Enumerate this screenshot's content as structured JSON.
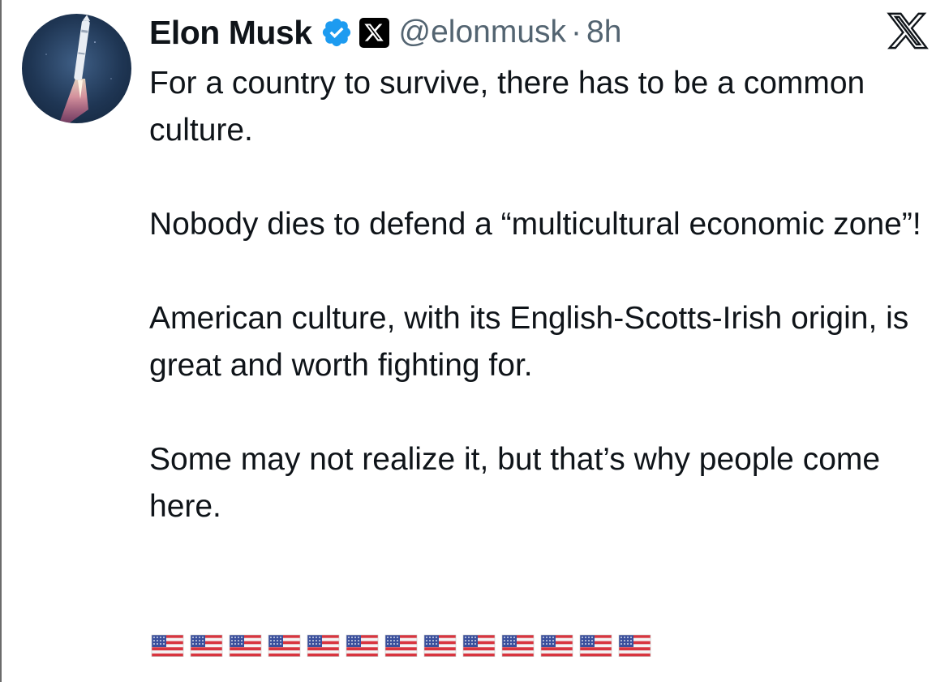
{
  "tweet": {
    "author_name": "Elon Musk",
    "handle": "@elonmusk",
    "separator": "·",
    "time": "8h",
    "paragraphs": [
      "For a country to survive, there has to be a common culture.",
      "Nobody dies to defend a “multicultural economic zone”!",
      "American culture, with its English-Scotts-Irish origin, is great and worth fighting for.",
      "Some may not realize it, but that’s why people come here."
    ],
    "flag_count": 13,
    "flag_icon": "us-flag-emoji"
  },
  "icons": {
    "verified": "verified-badge-icon",
    "affiliation": "x-logo-icon",
    "close": "x-logo-icon"
  },
  "colors": {
    "text": "#0f1419",
    "secondary": "#536471",
    "verified_blue": "#1d9bf0"
  }
}
